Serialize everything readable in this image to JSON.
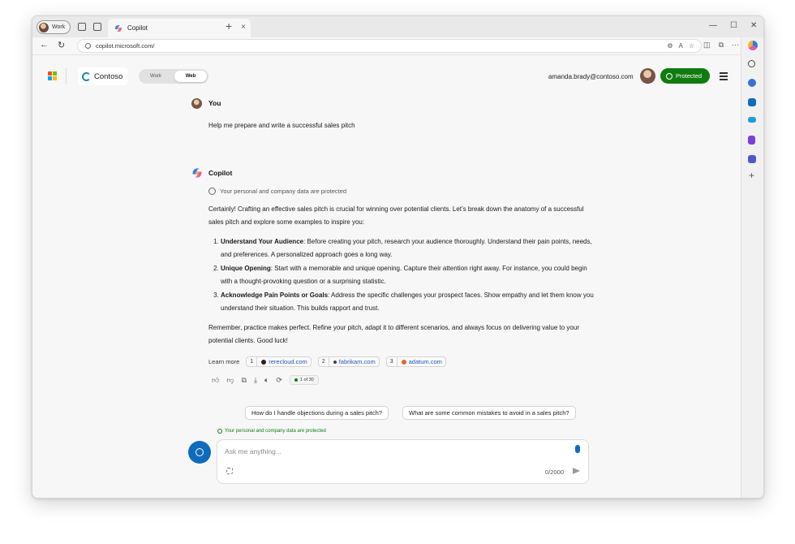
{
  "browser": {
    "profile_label": "Work",
    "tab_title": "Copilot",
    "url": "copilot.microsoft.com/"
  },
  "header": {
    "brand": "Contoso",
    "toggle_work": "Work",
    "toggle_web": "Web",
    "active_mode": "Web",
    "user_email": "amanda.brady@contoso.com",
    "protected_label": "Protected"
  },
  "chat": {
    "user_name": "You",
    "user_message": "Help me prepare and write a successful sales pitch",
    "assistant_name": "Copilot",
    "protection_notice": "Your personal and company data are protected",
    "intro": "Certainly! Crafting an effective sales pitch is crucial for winning over potential clients. Let’s break down the anatomy of a successful sales pitch and explore some examples to inspire you:",
    "points": [
      {
        "title": "Understand Your Audience",
        "text": ": Before creating your pitch, research your audience thoroughly. Understand their pain points, needs, and preferences. A personalized approach goes a long way."
      },
      {
        "title": "Unique Opening",
        "text": ": Start with a memorable and unique opening. Capture their attention right away. For instance, you could begin with a thought-provoking question or a surprising statistic."
      },
      {
        "title": "Acknowledge Pain Points or Goals",
        "text": ": Address the specific challenges your prospect faces. Show empathy and let them know you understand their situation. This builds rapport and trust."
      }
    ],
    "closing": "Remember, practice makes perfect. Refine your pitch, adapt it to different scenarios, and always focus on delivering value to your potential clients. Good luck!",
    "learn_more_label": "Learn more",
    "sources": [
      {
        "num": "1",
        "label": "rerecloud.com",
        "color": "#222222"
      },
      {
        "num": "2",
        "label": "fabrikam.com",
        "color": "#444444"
      },
      {
        "num": "3",
        "label": "adatum.com",
        "color": "#e8612c"
      }
    ],
    "response_counter": "1 of 30"
  },
  "suggestions": [
    "How do I handle objections during a sales pitch?",
    "What are some common mistakes to avoid in a sales pitch?"
  ],
  "composer": {
    "protection_notice": "Your personal and company data are protected",
    "placeholder": "Ask me anything...",
    "char_count": "0/2000"
  },
  "colors": {
    "accent_blue": "#0f6cbd",
    "protected_green": "#107c10",
    "link_blue": "#2456b8"
  }
}
